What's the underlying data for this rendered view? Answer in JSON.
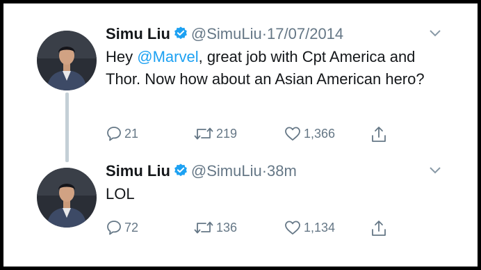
{
  "tweets": [
    {
      "name": "Simu Liu",
      "handle": "@SimuLiu",
      "separator": "·",
      "time": "17/07/2014",
      "text_before": "Hey ",
      "mention": "@Marvel",
      "text_after": ", great job with Cpt America and Thor. Now how about an Asian American hero?",
      "replies": "21",
      "retweets": "219",
      "likes": "1,366"
    },
    {
      "name": "Simu Liu",
      "handle": "@SimuLiu",
      "separator": "·",
      "time": "38m",
      "text": "LOL",
      "replies": "72",
      "retweets": "136",
      "likes": "1,134"
    }
  ],
  "colors": {
    "verified": "#1da1f2",
    "mention": "#1da1f2",
    "secondary_text": "#657786",
    "thread_line": "#c4cfd6"
  },
  "icons": [
    "verified-badge-icon",
    "chevron-down-icon",
    "reply-icon",
    "retweet-icon",
    "like-icon",
    "share-icon"
  ]
}
